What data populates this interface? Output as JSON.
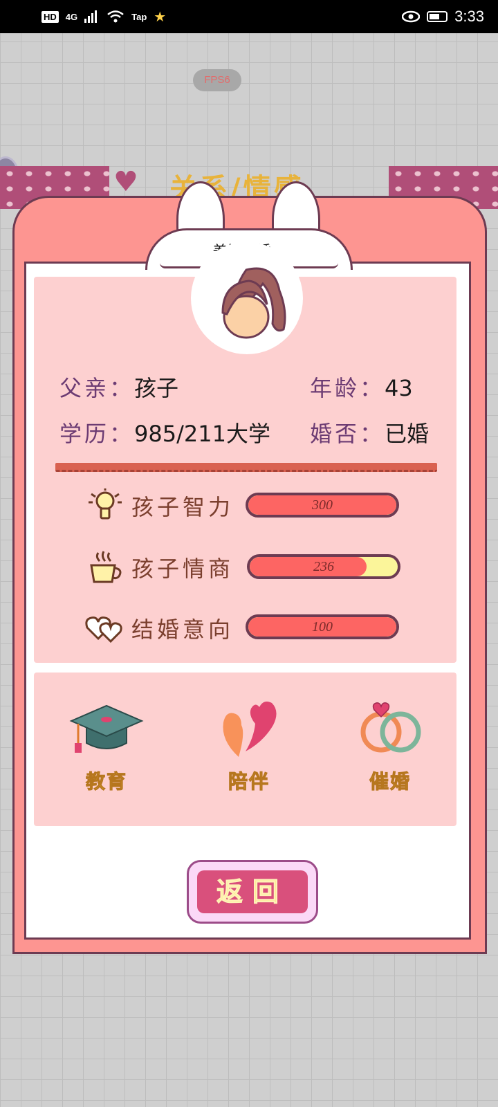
{
  "status_bar": {
    "network": "HD",
    "signal": "4G",
    "app_badge": "Tap",
    "time": "3:33"
  },
  "background": {
    "fps": "FPS6",
    "title": "关系/情感"
  },
  "dialog": {
    "speech": "差钱结婚。",
    "info": {
      "relation_label": "父亲：",
      "relation_value": "孩子",
      "age_label": "年龄：",
      "age_value": "43",
      "education_label": "学历：",
      "education_value": "985/211大学",
      "marital_label": "婚否：",
      "marital_value": "已婚"
    },
    "stats": [
      {
        "label": "孩子智力",
        "value": "300",
        "fill": 1.0,
        "icon": "lightbulb-icon"
      },
      {
        "label": "孩子情商",
        "value": "236",
        "fill": 0.79,
        "icon": "coffee-cup-icon"
      },
      {
        "label": "结婚意向",
        "value": "100",
        "fill": 1.0,
        "icon": "hearts-icon"
      }
    ],
    "actions": [
      {
        "label": "教育",
        "icon": "graduation-cap-icon"
      },
      {
        "label": "陪伴",
        "icon": "two-hearts-icon"
      },
      {
        "label": "催婚",
        "icon": "rings-icon"
      }
    ],
    "back_label": "返回"
  },
  "colors": {
    "frame": "#fd9591",
    "panel": "#fdd0d0",
    "bar_fill": "#fd6563",
    "bar_empty": "#fbf59a",
    "action_text": "#f7c33b",
    "back_button": "#d9507c"
  }
}
